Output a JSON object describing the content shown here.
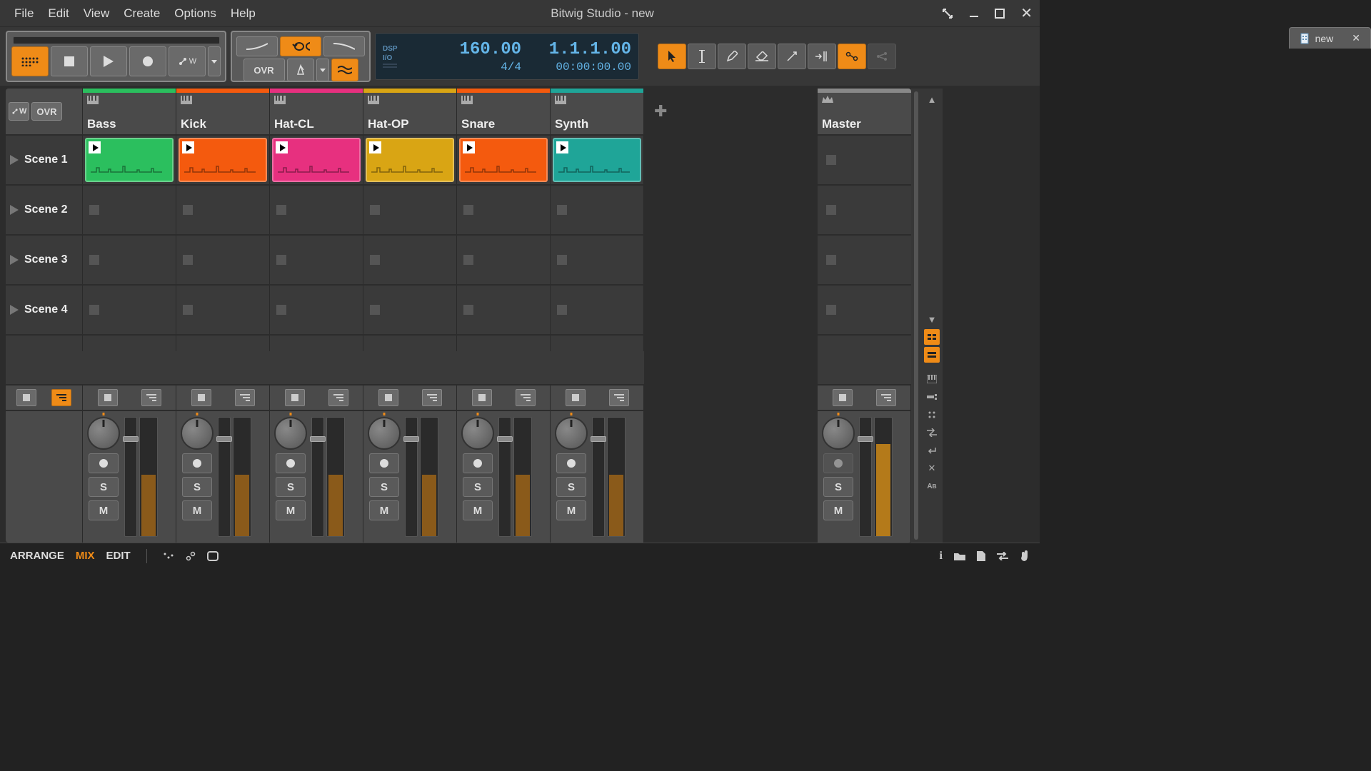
{
  "menu": {
    "file": "File",
    "edit": "Edit",
    "view": "View",
    "create": "Create",
    "options": "Options",
    "help": "Help"
  },
  "title": "Bitwig Studio - new",
  "tab": {
    "name": "new"
  },
  "transport": {
    "ovr": "OVR",
    "automation_w": "W"
  },
  "display": {
    "dsp_label": "DSP",
    "io_label": "I/O",
    "tempo": "160.00",
    "time_sig": "4/4",
    "position": "1.1.1.00",
    "timecode": "00:00:00.00"
  },
  "scene_header": {
    "ovr": "OVR",
    "w": "W"
  },
  "tracks": [
    {
      "name": "Bass",
      "color": "#2bbf5e"
    },
    {
      "name": "Kick",
      "color": "#f45a0e"
    },
    {
      "name": "Hat-CL",
      "color": "#e7307f"
    },
    {
      "name": "Hat-OP",
      "color": "#d9a514"
    },
    {
      "name": "Snare",
      "color": "#f45a0e"
    },
    {
      "name": "Synth",
      "color": "#1fa598"
    }
  ],
  "master": {
    "name": "Master"
  },
  "scenes": [
    {
      "name": "Scene 1",
      "has_clips": true
    },
    {
      "name": "Scene 2",
      "has_clips": false
    },
    {
      "name": "Scene 3",
      "has_clips": false
    },
    {
      "name": "Scene 4",
      "has_clips": false
    }
  ],
  "mixer": {
    "solo": "S",
    "mute": "M",
    "meter_fill_pct": 52,
    "master_meter_fill_pct": 78
  },
  "bottom": {
    "arrange": "ARRANGE",
    "mix": "MIX",
    "edit": "EDIT"
  }
}
